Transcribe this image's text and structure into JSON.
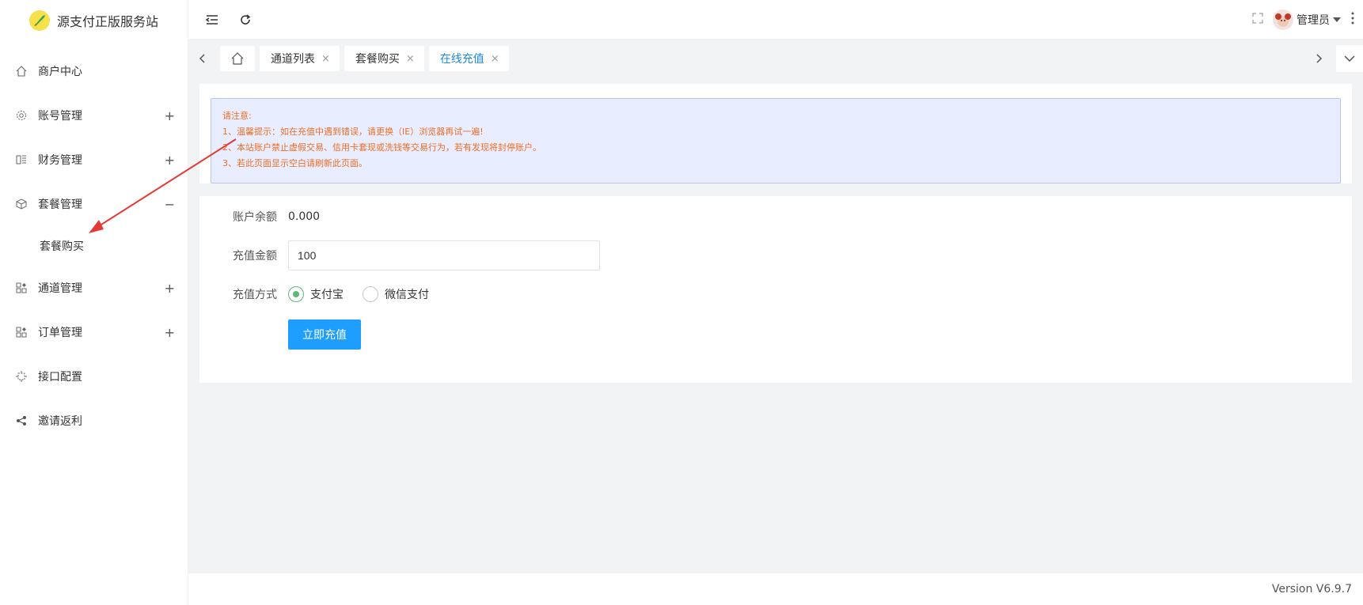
{
  "app": {
    "title": "源支付正版服务站"
  },
  "sidebar": {
    "items": [
      {
        "label": "商户中心",
        "icon": "home-icon",
        "toggle": ""
      },
      {
        "label": "账号管理",
        "icon": "gear-icon",
        "toggle": "+"
      },
      {
        "label": "财务管理",
        "icon": "finance-icon",
        "toggle": "+"
      },
      {
        "label": "套餐管理",
        "icon": "cube-icon",
        "toggle": "−"
      },
      {
        "label": "通道管理",
        "icon": "apps-icon",
        "toggle": "+"
      },
      {
        "label": "订单管理",
        "icon": "apps-icon",
        "toggle": "+"
      },
      {
        "label": "接口配置",
        "icon": "plug-icon",
        "toggle": ""
      },
      {
        "label": "邀请返利",
        "icon": "share-icon",
        "toggle": ""
      }
    ],
    "submenu": {
      "label": "套餐购买"
    }
  },
  "topbar": {
    "admin_name": "管理员"
  },
  "tabs": [
    {
      "label": "通道列表"
    },
    {
      "label": "套餐购买"
    },
    {
      "label": "在线充值"
    }
  ],
  "tab_close": "×",
  "notice": {
    "title": "请注意:",
    "line1": "1、温馨提示：如在充值中遇到错误，请更换（IE）浏览器再试一遍!",
    "line2": "2、本站账户禁止虚假交易、信用卡套现或洗钱等交易行为，若有发现将封停账户。",
    "line3": "3、若此页面显示空白请刷新此页面。"
  },
  "form": {
    "balance_label": "账户余额",
    "balance_value": "0.000",
    "amount_label": "充值金额",
    "amount_value": "100",
    "method_label": "充值方式",
    "method_options": [
      "支付宝",
      "微信支付"
    ],
    "submit_label": "立即充值"
  },
  "footer": {
    "version": "Version V6.9.7"
  },
  "colors": {
    "accent": "#1e9fff",
    "active_tab": "#1e88e5",
    "notice_text": "#ef6d24",
    "radio_checked": "#5fb878",
    "arrow": "#e53935"
  }
}
